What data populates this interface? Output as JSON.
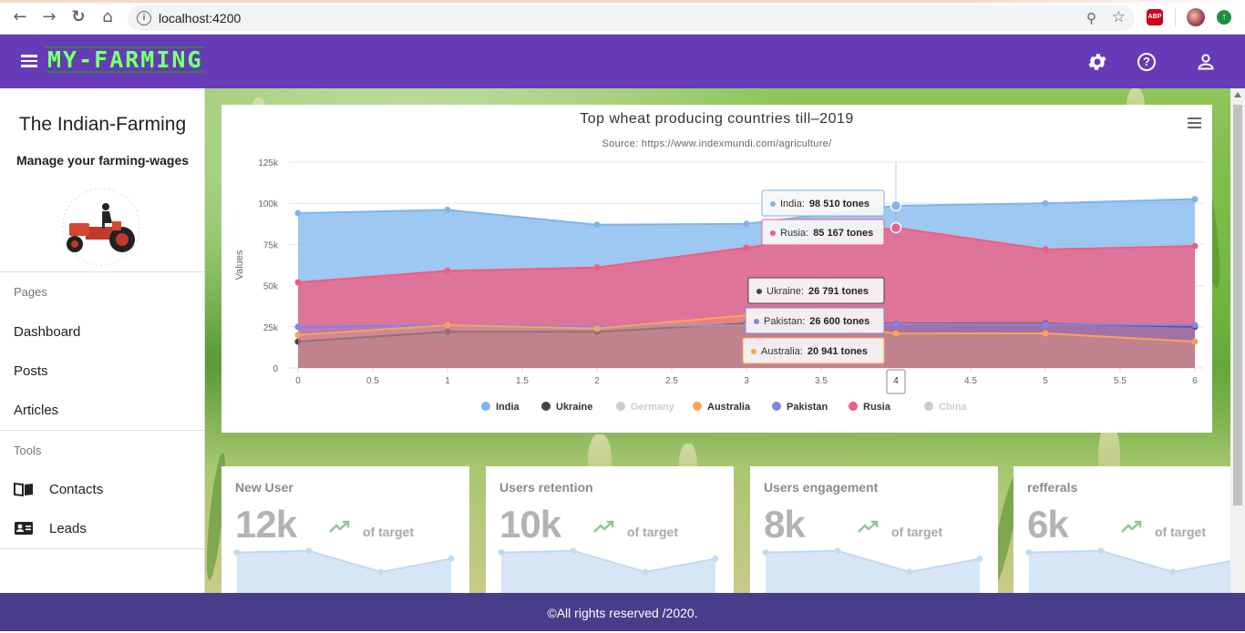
{
  "browser": {
    "url": "localhost:4200",
    "extension_label": "ABP"
  },
  "toolbar": {
    "brand": "MY-FARMING",
    "icons": [
      "menu-icon",
      "settings-icon",
      "help-icon",
      "account-icon"
    ],
    "color": "#673ab7"
  },
  "sidebar": {
    "title": "The Indian-Farming",
    "subtitle": "Manage your farming-wages",
    "sections": [
      {
        "label": "Pages",
        "items": [
          {
            "label": "Dashboard"
          },
          {
            "label": "Posts"
          },
          {
            "label": "Articles"
          }
        ]
      },
      {
        "label": "Tools",
        "items": [
          {
            "label": "Contacts",
            "icon": "book-icon"
          },
          {
            "label": "Leads",
            "icon": "contact-card-icon"
          }
        ]
      }
    ]
  },
  "chart_data": {
    "type": "area",
    "title": "Top wheat producing countries till–2019",
    "subtitle": "Source: https://www.indexmundi.com/agriculture/",
    "ylabel": "Values",
    "xlabel": "",
    "ylim": [
      0,
      125000
    ],
    "yticks": [
      "0",
      "25k",
      "50k",
      "75k",
      "100k",
      "125k"
    ],
    "xticks": [
      "0",
      "0.5",
      "1",
      "1.5",
      "2",
      "2.5",
      "3",
      "3.5",
      "4",
      "4.5",
      "5",
      "5.5",
      "6"
    ],
    "x": [
      0,
      1,
      2,
      3,
      4,
      5,
      6
    ],
    "series": [
      {
        "name": "India",
        "color": "#7cb5ec",
        "visible": true,
        "values": [
          94000,
          96000,
          87000,
          87500,
          98510,
          100000,
          102500
        ]
      },
      {
        "name": "Ukraine",
        "color": "#434348",
        "visible": true,
        "values": [
          16000,
          22000,
          22000,
          27000,
          26791,
          26800,
          25000
        ]
      },
      {
        "name": "Germany",
        "color": "#cccccc",
        "visible": false,
        "values": []
      },
      {
        "name": "Australia",
        "color": "#f7a35c",
        "visible": true,
        "values": [
          20000,
          26000,
          24000,
          32000,
          20941,
          21000,
          16000
        ]
      },
      {
        "name": "Pakistan",
        "color": "#8085e9",
        "visible": true,
        "values": [
          25000,
          26000,
          25000,
          26000,
          26600,
          26500,
          26000
        ]
      },
      {
        "name": "Rusia",
        "color": "#f15c80",
        "visible": true,
        "values": [
          52000,
          59000,
          61000,
          73000,
          85167,
          72000,
          74000
        ]
      },
      {
        "name": "China",
        "color": "#cccccc",
        "visible": false,
        "values": []
      }
    ],
    "tooltips": [
      {
        "series": "India",
        "label": "India:",
        "value": "98 510 tones"
      },
      {
        "series": "Rusia",
        "label": "Rusia:",
        "value": "85 167 tones"
      },
      {
        "series": "Ukraine",
        "label": "Ukraine:",
        "value": "26 791 tones"
      },
      {
        "series": "Pakistan",
        "label": "Pakistan:",
        "value": "26 600 tones"
      },
      {
        "series": "Australia",
        "label": "Australia:",
        "value": "20 941 tones"
      }
    ],
    "hover_x_label": "4",
    "legend_position": "bottom-center",
    "grid": true
  },
  "stats": [
    {
      "label": "New User",
      "value": "12k",
      "target": "of target",
      "spark": [
        60,
        62,
        35,
        52
      ]
    },
    {
      "label": "Users retention",
      "value": "10k",
      "target": "of target",
      "spark": [
        60,
        62,
        35,
        52
      ]
    },
    {
      "label": "Users engagement",
      "value": "8k",
      "target": "of target",
      "spark": [
        60,
        62,
        35,
        52
      ]
    },
    {
      "label": "refferals",
      "value": "6k",
      "target": "of target",
      "spark": [
        60,
        62,
        35,
        52
      ]
    }
  ],
  "footer": {
    "text": "©All rights reserved /2020."
  }
}
